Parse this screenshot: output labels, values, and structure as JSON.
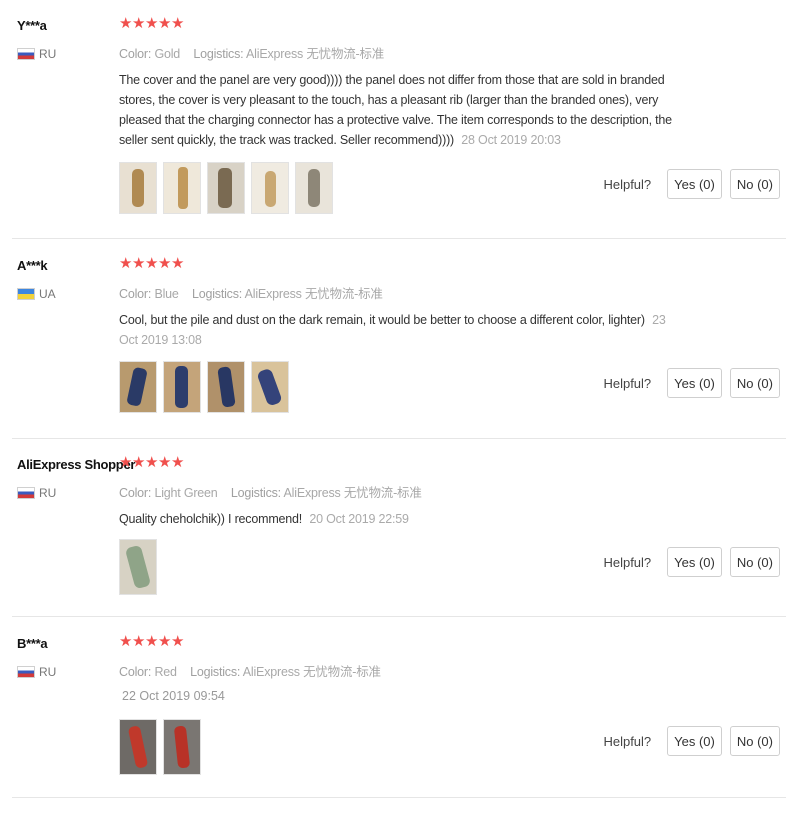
{
  "helpful_label": "Helpful?",
  "reviews": [
    {
      "user": "Y***a",
      "flag": "ru-flag-icon",
      "country": "RU",
      "stars": 5,
      "color_label": "Color:",
      "color": "Gold",
      "logistics_label": "Logistics:",
      "logistics": "AliExpress 无忧物流-标准",
      "text": "The cover and the panel are very good)))) the panel does not differ from those that are sold in branded stores, the cover is very pleasant to the touch, has a pleasant rib (larger than the branded ones), very pleased that the charging connector has a protective valve. The item corresponds to the description, the seller sent quickly, the track was tracked. Seller recommend))))",
      "date": "28 Oct 2019 20:03",
      "photos": 5,
      "yes": "Yes (0)",
      "no": "No (0)"
    },
    {
      "user": "A***k",
      "flag": "ua-flag-icon",
      "country": "UA",
      "stars": 5,
      "color_label": "Color:",
      "color": "Blue",
      "logistics_label": "Logistics:",
      "logistics": "AliExpress 无忧物流-标准",
      "text": "Cool, but the pile and dust on the dark remain, it would be better to choose a different color, lighter)",
      "date": "23 Oct 2019 13:08",
      "photos": 4,
      "yes": "Yes (0)",
      "no": "No (0)"
    },
    {
      "user": "AliExpress Shopper",
      "flag": "ru-flag-icon",
      "country": "RU",
      "stars": 5,
      "color_label": "Color:",
      "color": "Light Green",
      "logistics_label": "Logistics:",
      "logistics": "AliExpress 无忧物流-标准",
      "text": "Quality cheholchik)) I recommend!",
      "date": "20 Oct 2019 22:59",
      "photos": 1,
      "yes": "Yes (0)",
      "no": "No (0)"
    },
    {
      "user": "B***a",
      "flag": "ru-flag-icon",
      "country": "RU",
      "stars": 5,
      "color_label": "Color:",
      "color": "Red",
      "logistics_label": "Logistics:",
      "logistics": "AliExpress 无忧物流-标准",
      "text": "",
      "date": "22 Oct 2019 09:54",
      "photos": 2,
      "yes": "Yes (0)",
      "no": "No (0)"
    }
  ]
}
